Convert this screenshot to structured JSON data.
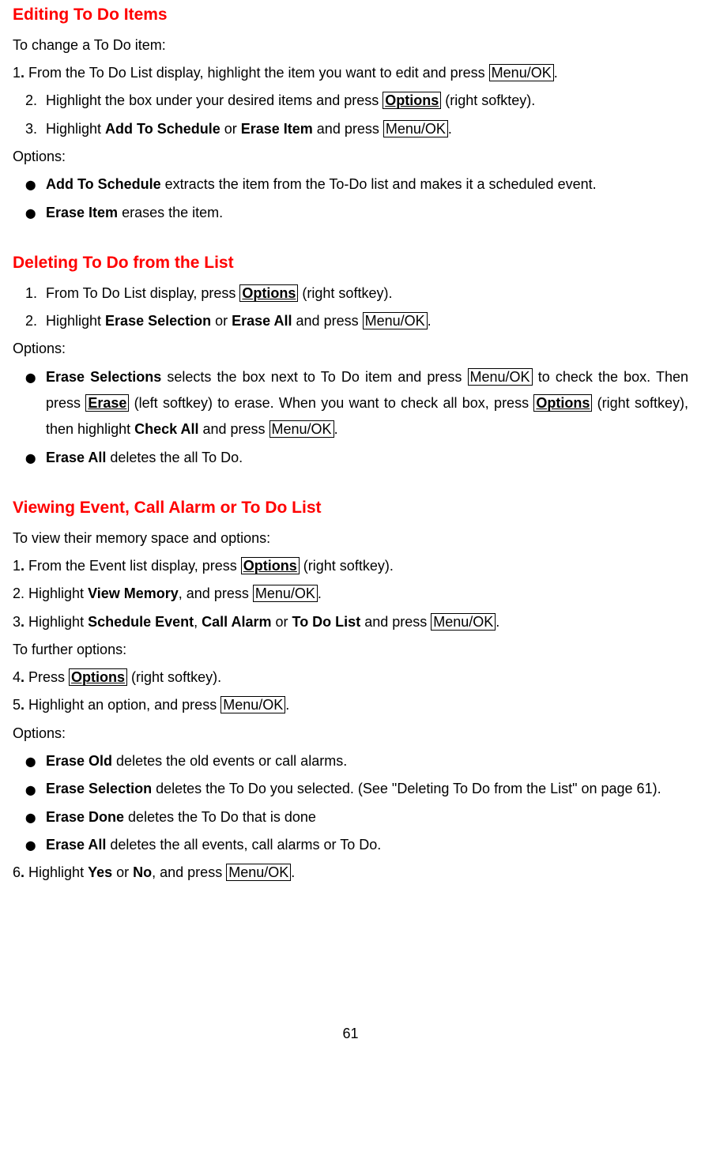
{
  "sec1": {
    "heading": "Editing To Do Items",
    "intro": "To change a To Do item:",
    "s1_pre": "1",
    "s1_a": ". From the To Do List display, highlight the item you want to edit and press ",
    "s1_key": "Menu/OK",
    "s1_end": ".",
    "s2_num": "2.",
    "s2_a": "Highlight the box under your desired items and press ",
    "s2_key": "Options",
    "s2_b": " (right sofktey).",
    "s3_num": "3.",
    "s3_a": "Highlight ",
    "s3_b1": "Add To Schedule",
    "s3_or": " or ",
    "s3_b2": "Erase Item",
    "s3_c": " and press ",
    "s3_key": "Menu/OK",
    "s3_end": ".",
    "opts": "Options:",
    "b1_bold": "Add To Schedule",
    "b1_txt": " extracts the item from the To-Do list and makes it a scheduled event.",
    "b2_bold": "Erase Item",
    "b2_txt": " erases the item."
  },
  "sec2": {
    "heading": "Deleting To Do from the List",
    "s1_num": "1.",
    "s1_a": "From To Do List display, press ",
    "s1_key": "Options",
    "s1_b": " (right softkey).",
    "s2_num": "2.",
    "s2_a": "Highlight ",
    "s2_b1": "Erase Selection",
    "s2_or": " or ",
    "s2_b2": "Erase All",
    "s2_c": " and press ",
    "s2_key": "Menu/OK",
    "s2_end": ".",
    "opts": "Options:",
    "b1_bold": "Erase Selections",
    "b1_a": " selects the box next to To Do item and press ",
    "b1_key1": "Menu/OK",
    "b1_b": " to check the box. Then press ",
    "b1_key2": "Erase",
    "b1_c": " (left softkey) to erase. When you want to check all box, press ",
    "b1_key3": "Options",
    "b1_d": " (right softkey), then highlight ",
    "b1_bold2": "Check All",
    "b1_e": " and press ",
    "b1_key4": "Menu/OK",
    "b1_end": ".",
    "b2_bold": "Erase All",
    "b2_txt": " deletes the all To Do."
  },
  "sec3": {
    "heading": "Viewing Event, Call Alarm or To Do List",
    "intro": "To view their memory space and options:",
    "s1_pre": "1",
    "s1_a": ". From the Event list display, press ",
    "s1_key": "Options",
    "s1_b": " (right softkey).",
    "s2_pre": "2. Highlight ",
    "s2_bold": "View Memory",
    "s2_a": ", and press ",
    "s2_key": "Menu/OK",
    "s2_end": ".",
    "s3_pre": "3",
    "s3_a": ". Highlight ",
    "s3_b1": "Schedule Event",
    "s3_c1": ", ",
    "s3_b2": "Call Alarm",
    "s3_or": " or ",
    "s3_b3": "To Do List",
    "s3_d": " and press ",
    "s3_key": "Menu/OK",
    "s3_end": ".",
    "further": "To further options:",
    "s4_pre": "4",
    "s4_a": ". Press ",
    "s4_key": "Options",
    "s4_b": " (right softkey).",
    "s5_pre": "5",
    "s5_a": ". Highlight an option, and press ",
    "s5_key": "Menu/OK",
    "s5_end": ".",
    "opts": "Options:",
    "b1_bold": "Erase Old",
    "b1_txt": " deletes the old events or call alarms.",
    "b2_bold": "Erase Selection",
    "b2_txt": " deletes the To Do you selected. (See \"Deleting To Do from the List\" on page 61).",
    "b3_bold": "Erase Done",
    "b3_txt": " deletes the To Do that is done",
    "b4_bold": "Erase All",
    "b4_txt": " deletes the all events, call alarms or To Do.",
    "s6_pre": "6",
    "s6_a": ". Highlight ",
    "s6_b1": "Yes",
    "s6_or": " or ",
    "s6_b2": "No",
    "s6_c": ", and press ",
    "s6_key": "Menu/OK",
    "s6_end": "."
  },
  "pagenum": "61",
  "bullet": "⬤"
}
